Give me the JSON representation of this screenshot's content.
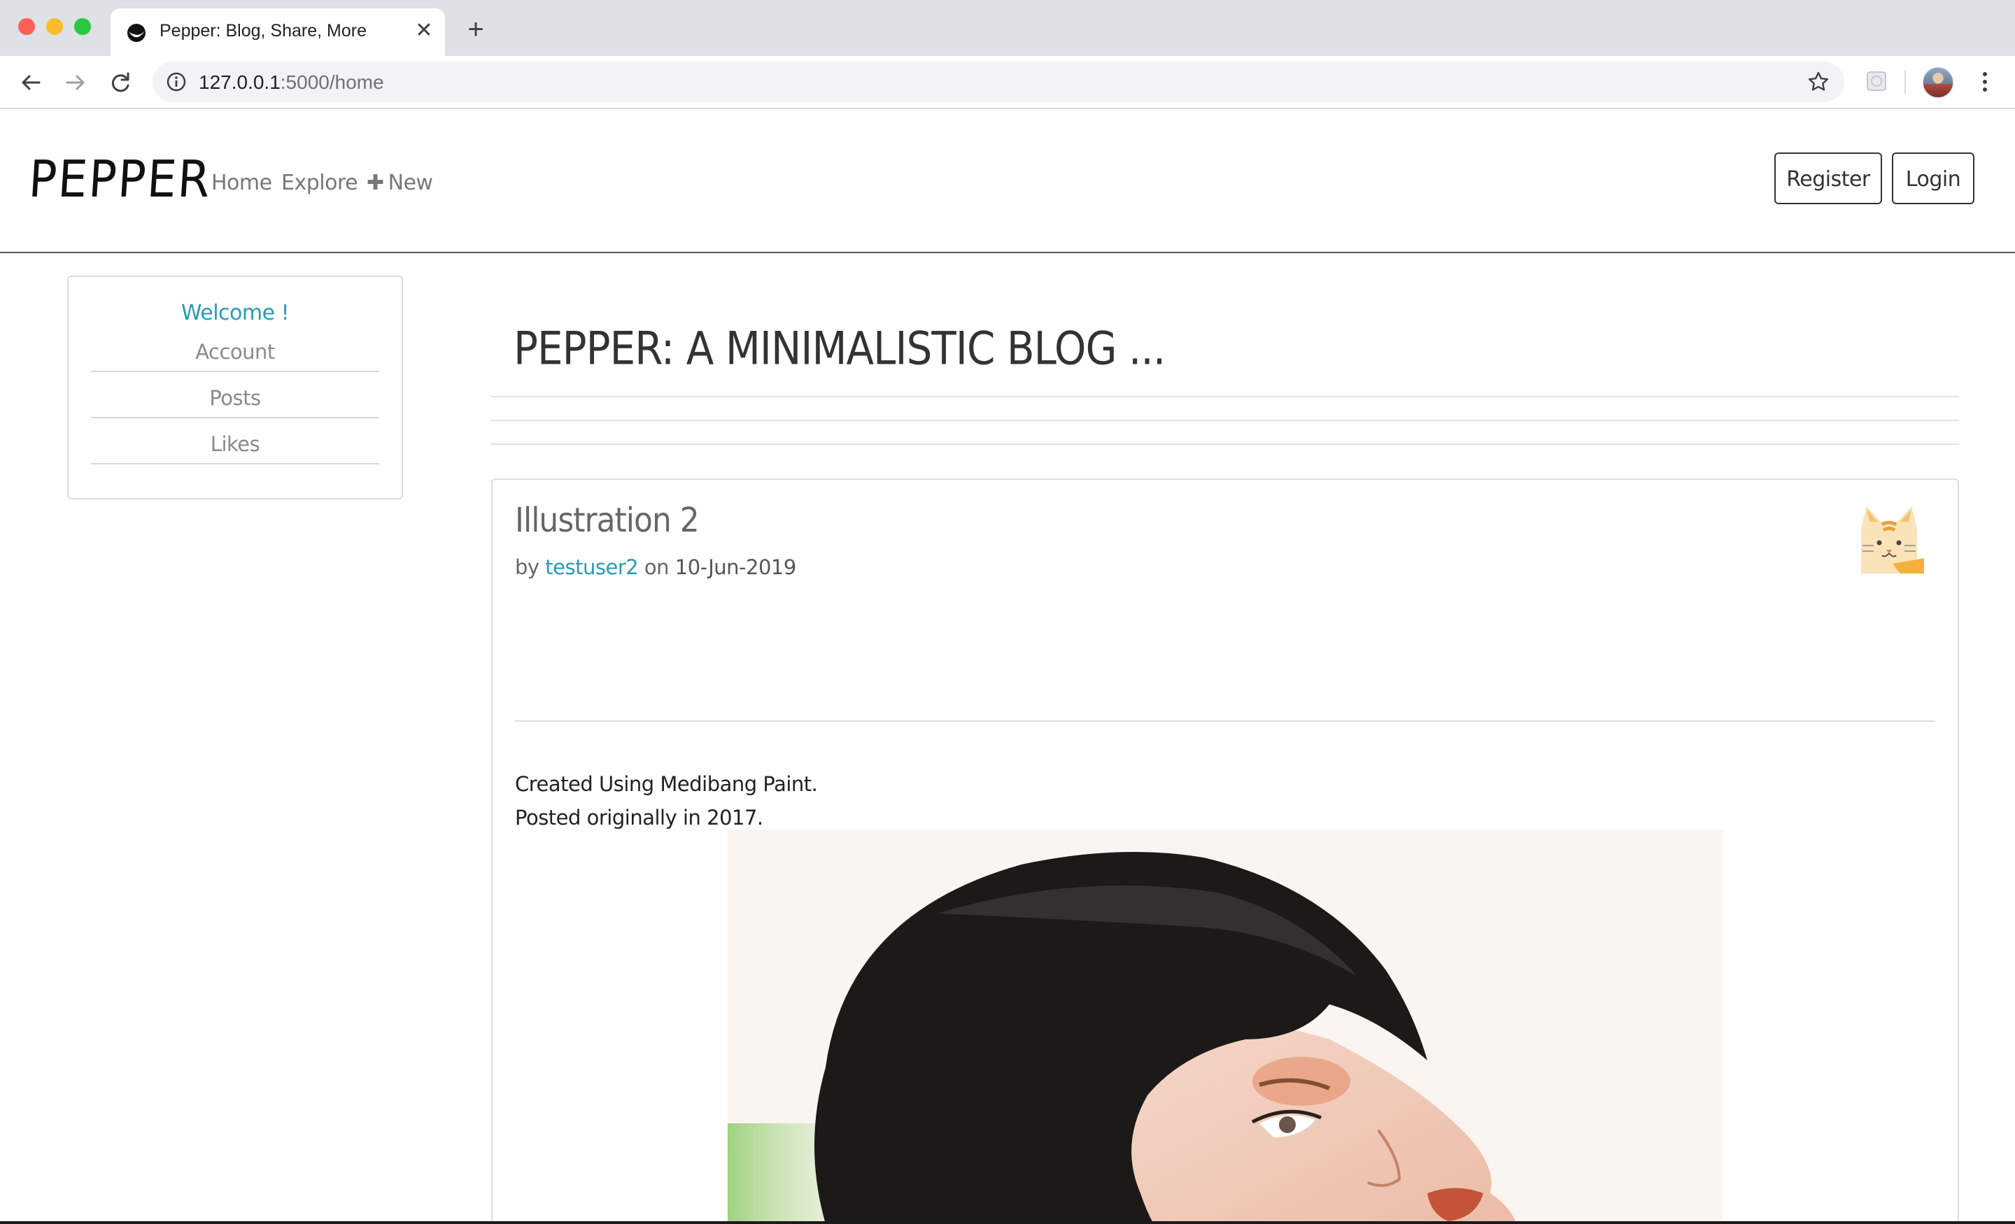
{
  "browser": {
    "tab_title": "Pepper: Blog, Share, More",
    "tab_close": "✕",
    "new_tab": "+",
    "url_host": "127.0.0.1",
    "url_rest": ":5000/home"
  },
  "navbar": {
    "brand": "PEPPER",
    "home": "Home",
    "explore": "Explore",
    "new_icon": "✚",
    "new": "New",
    "register": "Register",
    "login": "Login"
  },
  "sidebar": {
    "welcome": "Welcome !",
    "items": [
      {
        "label": "Account"
      },
      {
        "label": "Posts"
      },
      {
        "label": "Likes"
      }
    ]
  },
  "main": {
    "title": "PEPPER: A MINIMALISTIC BLOG ..."
  },
  "post": {
    "title": "Illustration 2",
    "by": "by",
    "author": "testuser2",
    "on": "on",
    "date": "10-Jun-2019",
    "body_line1": "Created Using Medibang Paint.",
    "body_line2": "Posted originally in 2017."
  },
  "colors": {
    "accent": "#2a9bb2",
    "chrome_tabstrip": "#dee1e6",
    "omnibox": "#f1f3f4"
  }
}
